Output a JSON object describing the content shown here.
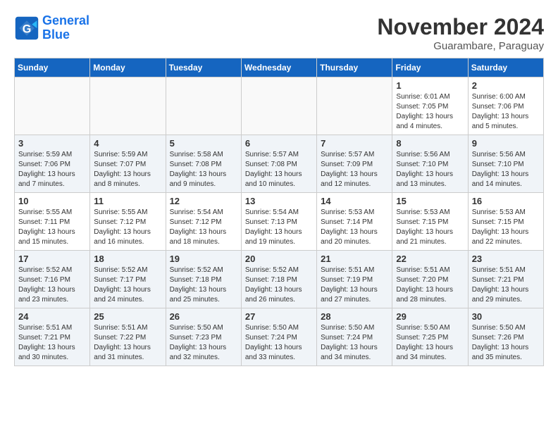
{
  "logo": {
    "line1": "General",
    "line2": "Blue"
  },
  "header": {
    "month_title": "November 2024",
    "subtitle": "Guarambare, Paraguay"
  },
  "days_of_week": [
    "Sunday",
    "Monday",
    "Tuesday",
    "Wednesday",
    "Thursday",
    "Friday",
    "Saturday"
  ],
  "weeks": [
    [
      {
        "day": "",
        "info": ""
      },
      {
        "day": "",
        "info": ""
      },
      {
        "day": "",
        "info": ""
      },
      {
        "day": "",
        "info": ""
      },
      {
        "day": "",
        "info": ""
      },
      {
        "day": "1",
        "info": "Sunrise: 6:01 AM\nSunset: 7:05 PM\nDaylight: 13 hours and 4 minutes."
      },
      {
        "day": "2",
        "info": "Sunrise: 6:00 AM\nSunset: 7:06 PM\nDaylight: 13 hours and 5 minutes."
      }
    ],
    [
      {
        "day": "3",
        "info": "Sunrise: 5:59 AM\nSunset: 7:06 PM\nDaylight: 13 hours and 7 minutes."
      },
      {
        "day": "4",
        "info": "Sunrise: 5:59 AM\nSunset: 7:07 PM\nDaylight: 13 hours and 8 minutes."
      },
      {
        "day": "5",
        "info": "Sunrise: 5:58 AM\nSunset: 7:08 PM\nDaylight: 13 hours and 9 minutes."
      },
      {
        "day": "6",
        "info": "Sunrise: 5:57 AM\nSunset: 7:08 PM\nDaylight: 13 hours and 10 minutes."
      },
      {
        "day": "7",
        "info": "Sunrise: 5:57 AM\nSunset: 7:09 PM\nDaylight: 13 hours and 12 minutes."
      },
      {
        "day": "8",
        "info": "Sunrise: 5:56 AM\nSunset: 7:10 PM\nDaylight: 13 hours and 13 minutes."
      },
      {
        "day": "9",
        "info": "Sunrise: 5:56 AM\nSunset: 7:10 PM\nDaylight: 13 hours and 14 minutes."
      }
    ],
    [
      {
        "day": "10",
        "info": "Sunrise: 5:55 AM\nSunset: 7:11 PM\nDaylight: 13 hours and 15 minutes."
      },
      {
        "day": "11",
        "info": "Sunrise: 5:55 AM\nSunset: 7:12 PM\nDaylight: 13 hours and 16 minutes."
      },
      {
        "day": "12",
        "info": "Sunrise: 5:54 AM\nSunset: 7:12 PM\nDaylight: 13 hours and 18 minutes."
      },
      {
        "day": "13",
        "info": "Sunrise: 5:54 AM\nSunset: 7:13 PM\nDaylight: 13 hours and 19 minutes."
      },
      {
        "day": "14",
        "info": "Sunrise: 5:53 AM\nSunset: 7:14 PM\nDaylight: 13 hours and 20 minutes."
      },
      {
        "day": "15",
        "info": "Sunrise: 5:53 AM\nSunset: 7:15 PM\nDaylight: 13 hours and 21 minutes."
      },
      {
        "day": "16",
        "info": "Sunrise: 5:53 AM\nSunset: 7:15 PM\nDaylight: 13 hours and 22 minutes."
      }
    ],
    [
      {
        "day": "17",
        "info": "Sunrise: 5:52 AM\nSunset: 7:16 PM\nDaylight: 13 hours and 23 minutes."
      },
      {
        "day": "18",
        "info": "Sunrise: 5:52 AM\nSunset: 7:17 PM\nDaylight: 13 hours and 24 minutes."
      },
      {
        "day": "19",
        "info": "Sunrise: 5:52 AM\nSunset: 7:18 PM\nDaylight: 13 hours and 25 minutes."
      },
      {
        "day": "20",
        "info": "Sunrise: 5:52 AM\nSunset: 7:18 PM\nDaylight: 13 hours and 26 minutes."
      },
      {
        "day": "21",
        "info": "Sunrise: 5:51 AM\nSunset: 7:19 PM\nDaylight: 13 hours and 27 minutes."
      },
      {
        "day": "22",
        "info": "Sunrise: 5:51 AM\nSunset: 7:20 PM\nDaylight: 13 hours and 28 minutes."
      },
      {
        "day": "23",
        "info": "Sunrise: 5:51 AM\nSunset: 7:21 PM\nDaylight: 13 hours and 29 minutes."
      }
    ],
    [
      {
        "day": "24",
        "info": "Sunrise: 5:51 AM\nSunset: 7:21 PM\nDaylight: 13 hours and 30 minutes."
      },
      {
        "day": "25",
        "info": "Sunrise: 5:51 AM\nSunset: 7:22 PM\nDaylight: 13 hours and 31 minutes."
      },
      {
        "day": "26",
        "info": "Sunrise: 5:50 AM\nSunset: 7:23 PM\nDaylight: 13 hours and 32 minutes."
      },
      {
        "day": "27",
        "info": "Sunrise: 5:50 AM\nSunset: 7:24 PM\nDaylight: 13 hours and 33 minutes."
      },
      {
        "day": "28",
        "info": "Sunrise: 5:50 AM\nSunset: 7:24 PM\nDaylight: 13 hours and 34 minutes."
      },
      {
        "day": "29",
        "info": "Sunrise: 5:50 AM\nSunset: 7:25 PM\nDaylight: 13 hours and 34 minutes."
      },
      {
        "day": "30",
        "info": "Sunrise: 5:50 AM\nSunset: 7:26 PM\nDaylight: 13 hours and 35 minutes."
      }
    ]
  ]
}
